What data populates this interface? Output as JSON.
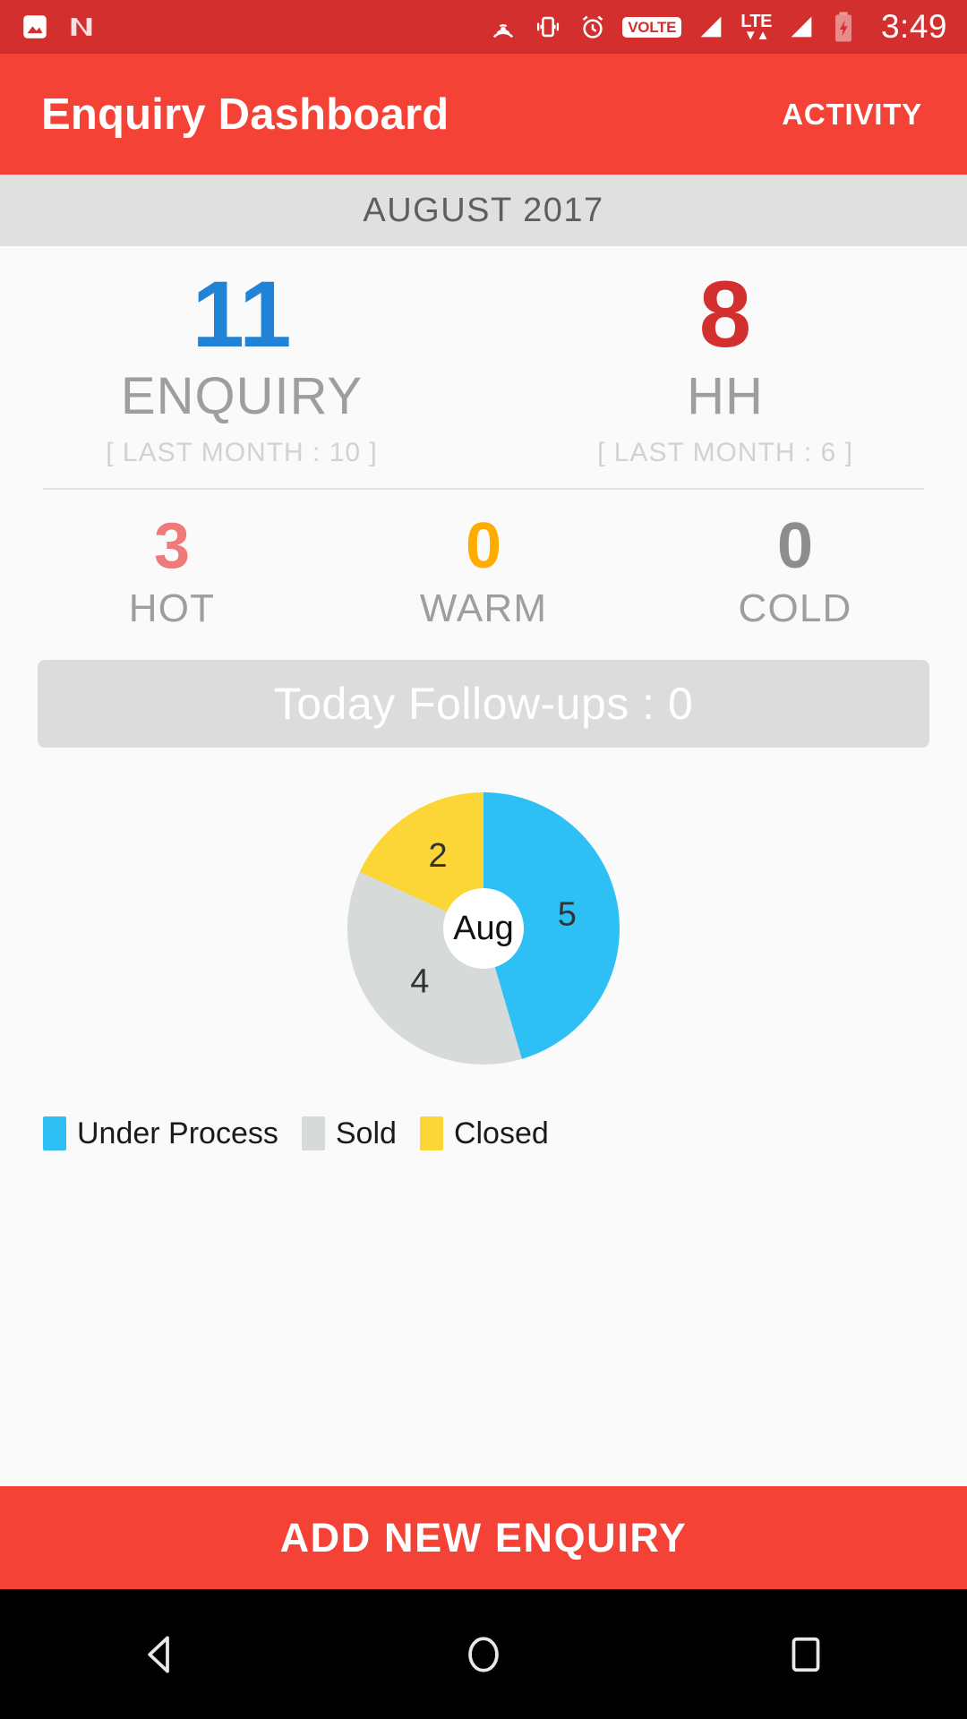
{
  "status_bar": {
    "time": "3:49",
    "volte_label": "VOLTE",
    "lte_label": "LTE",
    "icons": [
      "image-icon",
      "android-nougat-icon",
      "cast-icon",
      "vibrate-icon",
      "alarm-icon",
      "volte-icon",
      "signal-icon",
      "lte-data-icon",
      "signal-2-icon",
      "battery-charging-icon"
    ]
  },
  "appbar": {
    "title": "Enquiry Dashboard",
    "activity_label": "ACTIVITY",
    "background": "#f44336"
  },
  "month_bar": {
    "label": "AUGUST 2017"
  },
  "stats": {
    "primary": [
      {
        "value": "11",
        "label": "ENQUIRY",
        "sub": "[ LAST MONTH : 10 ]",
        "color": "#2083d5"
      },
      {
        "value": "8",
        "label": "HH",
        "sub": "[ LAST MONTH : 6 ]",
        "color": "#d32f2f"
      }
    ],
    "secondary": [
      {
        "value": "3",
        "label": "HOT",
        "color": "#ef7a7a"
      },
      {
        "value": "0",
        "label": "WARM",
        "color": "#ffab00"
      },
      {
        "value": "0",
        "label": "COLD",
        "color": "#8d8d8d"
      }
    ]
  },
  "followups": {
    "label": "Today Follow-ups : 0"
  },
  "chart_data": {
    "type": "pie",
    "title": "",
    "center_label": "Aug",
    "categories": [
      "Under Process",
      "Sold",
      "Closed"
    ],
    "values": [
      5,
      4,
      2
    ],
    "colors": [
      "#2ec0f5",
      "#d6dbda",
      "#fcd536"
    ],
    "data_labels": [
      "5",
      "4",
      "2"
    ],
    "total": 11,
    "legend_position": "bottom-left",
    "start_angle_deg": 0,
    "direction": "clockwise",
    "slices": [
      {
        "name": "Under Process",
        "value": 5,
        "color": "#2ec0f5",
        "label": "5"
      },
      {
        "name": "Sold",
        "value": 4,
        "color": "#d6dbda",
        "label": "4"
      },
      {
        "name": "Closed",
        "value": 2,
        "color": "#fcd536",
        "label": "2"
      }
    ]
  },
  "cta": {
    "label": "ADD NEW ENQUIRY"
  },
  "navbar": {
    "back": "back-nav-icon",
    "home": "home-nav-icon",
    "recents": "recents-nav-icon"
  }
}
